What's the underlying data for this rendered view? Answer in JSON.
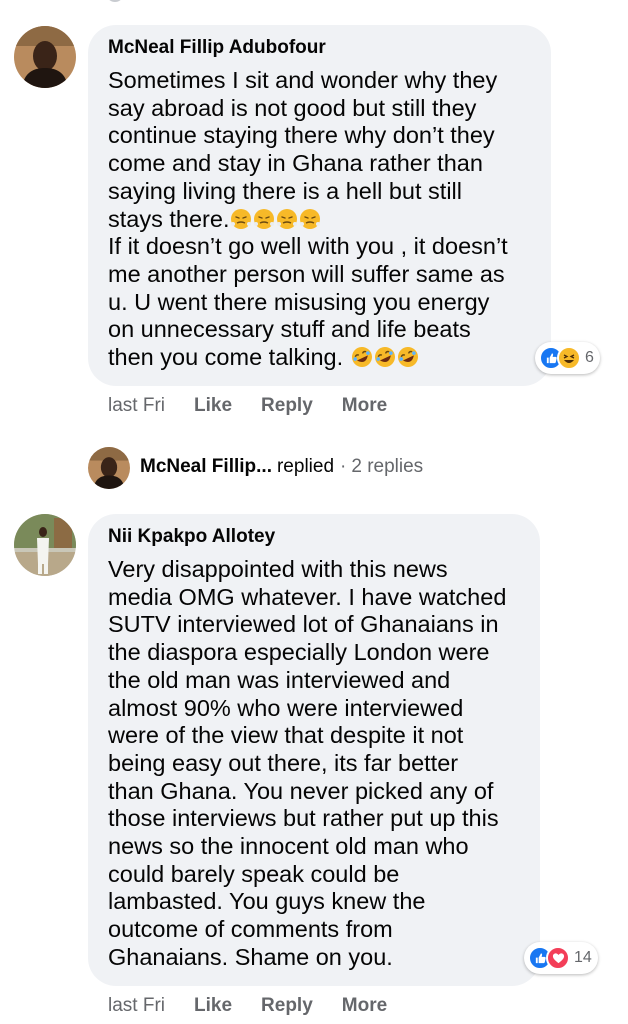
{
  "comments": [
    {
      "author": "McNeal Fillip Adubofour",
      "lines": [
        "Sometimes I sit and wonder why they",
        "say abroad is not good but still they",
        "continue staying there why don’t they",
        "come and stay in Ghana rather than",
        "saying living there is a hell but still",
        "stays there.",
        "If it doesn’t go well with you , it doesn’t",
        "me another person will suffer same as",
        "u. U went there misusing you energy",
        "on unnecessary stuff and life beats",
        "then you come talking. "
      ],
      "emoji_after_line_6": [
        "triumph-face",
        "triumph-face",
        "triumph-face",
        "triumph-face"
      ],
      "emoji_after_line_11": [
        "rolling-laughing-face",
        "rolling-laughing-face",
        "rolling-laughing-face"
      ],
      "time": "last Fri",
      "actions": [
        "Like",
        "Reply",
        "More"
      ],
      "reactions": {
        "icons": [
          "like-icon",
          "haha-icon"
        ],
        "count": "6"
      }
    },
    {
      "author": "Nii Kpakpo Allotey",
      "lines": [
        "Very disappointed with this news",
        "media OMG whatever. I have watched",
        "SUTV interviewed lot of Ghanaians in",
        "the diaspora especially London were",
        "the old man was interviewed and",
        "almost 90% who were interviewed",
        "were of the view that despite it not",
        "being easy out there, its far better",
        "than Ghana. You never picked any of",
        "those interviews but rather put up this",
        "news so the innocent old man who",
        "could barely speak could be",
        "lambasted. You guys knew the",
        "outcome of comments from",
        "Ghanaians. Shame on you."
      ],
      "time": "last Fri",
      "actions": [
        "Like",
        "Reply",
        "More"
      ],
      "reactions": {
        "icons": [
          "like-icon",
          "love-icon"
        ],
        "count": "14"
      }
    }
  ],
  "reply_summary": {
    "name": "McNeal Fillip...",
    "verb": "replied",
    "separator": "·",
    "count": "2 replies"
  },
  "colors": {
    "bubble": "#f0f2f5",
    "meta_text": "#65676b",
    "like_blue": "#1877f2",
    "haha_yellow": "#f7b928",
    "love_red": "#f33e58"
  }
}
